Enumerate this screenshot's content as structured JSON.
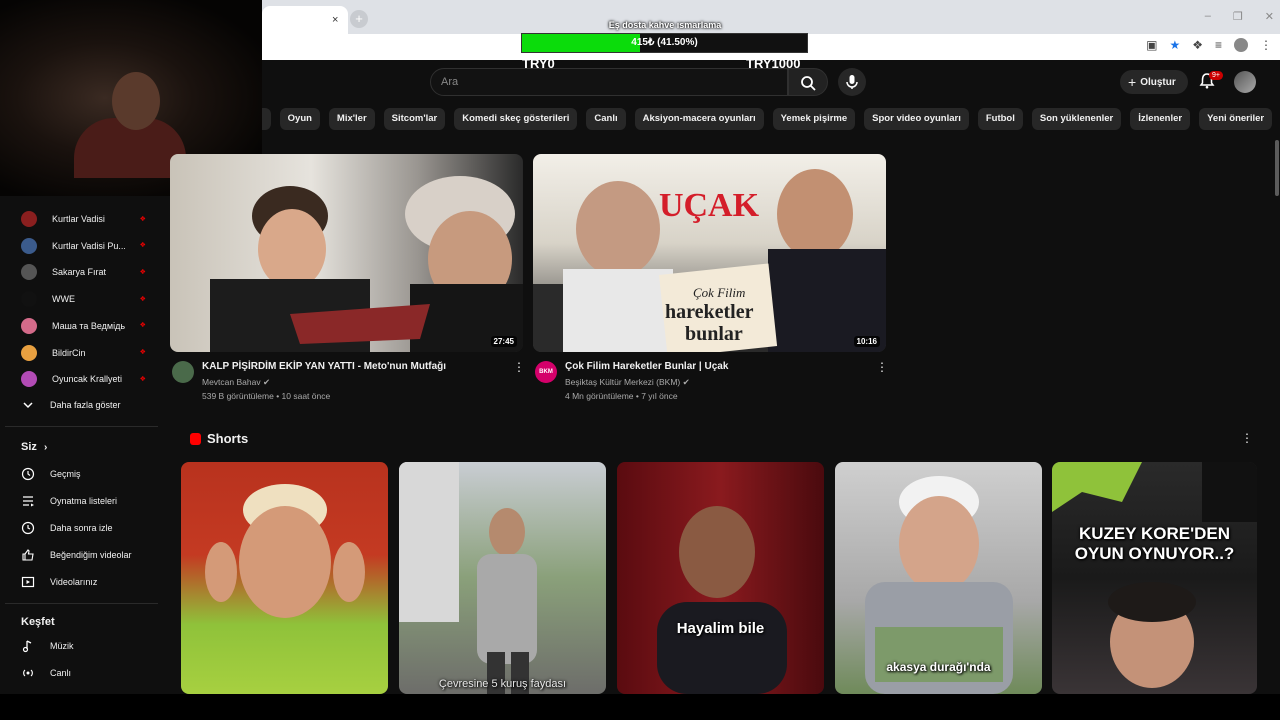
{
  "overlay": {
    "donation_title": "Eş dosta kahve ısmarlama",
    "donation_progress_text": "415₺ (41.50%)",
    "donation_progress": 0.415,
    "goal_left": "TRY0",
    "goal_right": "TRY1000",
    "fill_color": "#0bdc0b"
  },
  "browser": {
    "tab_close": "×",
    "new_tab": "+"
  },
  "header": {
    "search_placeholder": "Ara",
    "create_label": "Oluştur",
    "notification_count": "9+"
  },
  "chips": [
    "Oyun",
    "Mix'ler",
    "Sitcom'lar",
    "Komedi skeç gösterileri",
    "Canlı",
    "Aksiyon-macera oyunları",
    "Yemek pişirme",
    "Spor video oyunları",
    "Futbol",
    "Son yüklenenler",
    "İzlenenler",
    "Yeni öneriler"
  ],
  "sidebar": {
    "subscriptions": [
      {
        "label": "Kurtlar Vadisi",
        "color": "#8a1f1f"
      },
      {
        "label": "Kurtlar Vadisi Pu...",
        "color": "#3b5b8c"
      },
      {
        "label": "Sakarya Fırat",
        "color": "#555"
      },
      {
        "label": "WWE",
        "color": "#111"
      },
      {
        "label": "Маша та Ведмідь",
        "color": "#d46b8a"
      },
      {
        "label": "BildirCin",
        "color": "#e8a040"
      },
      {
        "label": "Oyuncak Krallyeti",
        "color": "#b24bb5"
      }
    ],
    "show_more": "Daha fazla göster",
    "you_title": "Siz",
    "you_items": [
      "Geçmiş",
      "Oynatma listeleri",
      "Daha sonra izle",
      "Beğendiğim videolar",
      "Videolarınız"
    ],
    "explore_title": "Keşfet",
    "explore_items": [
      "Müzik",
      "Canlı"
    ]
  },
  "videos": [
    {
      "title": "KALP PİŞİRDİM EKİP YAN YATTI - Meto'nun Mutfağı",
      "channel": "Mevtcan Bahav",
      "meta": "539 B görüntüleme • 10 saat önce",
      "duration": "27:45"
    },
    {
      "title": "Çok Filim Hareketler Bunlar | Uçak",
      "channel": "Beşiktaş Kültür Merkezi (BKM)",
      "meta": "4 Mn görüntüleme • 7 yıl önce",
      "duration": "10:16",
      "thumb_title": "UÇAK",
      "thumb_logo_line1": "Çok Filim",
      "thumb_logo_line2": "hareketler",
      "thumb_logo_line3": "bunlar",
      "avatar_text": "BKM"
    }
  ],
  "shorts": {
    "title": "Shorts",
    "items": [
      {
        "caption": ""
      },
      {
        "caption": "Çevresine 5 kuruş faydası"
      },
      {
        "caption": "Hayalim bile"
      },
      {
        "caption": "akasya durağı'nda"
      },
      {
        "caption": "KUZEY KORE'DEN OYUN OYNUYOR..?"
      }
    ]
  }
}
